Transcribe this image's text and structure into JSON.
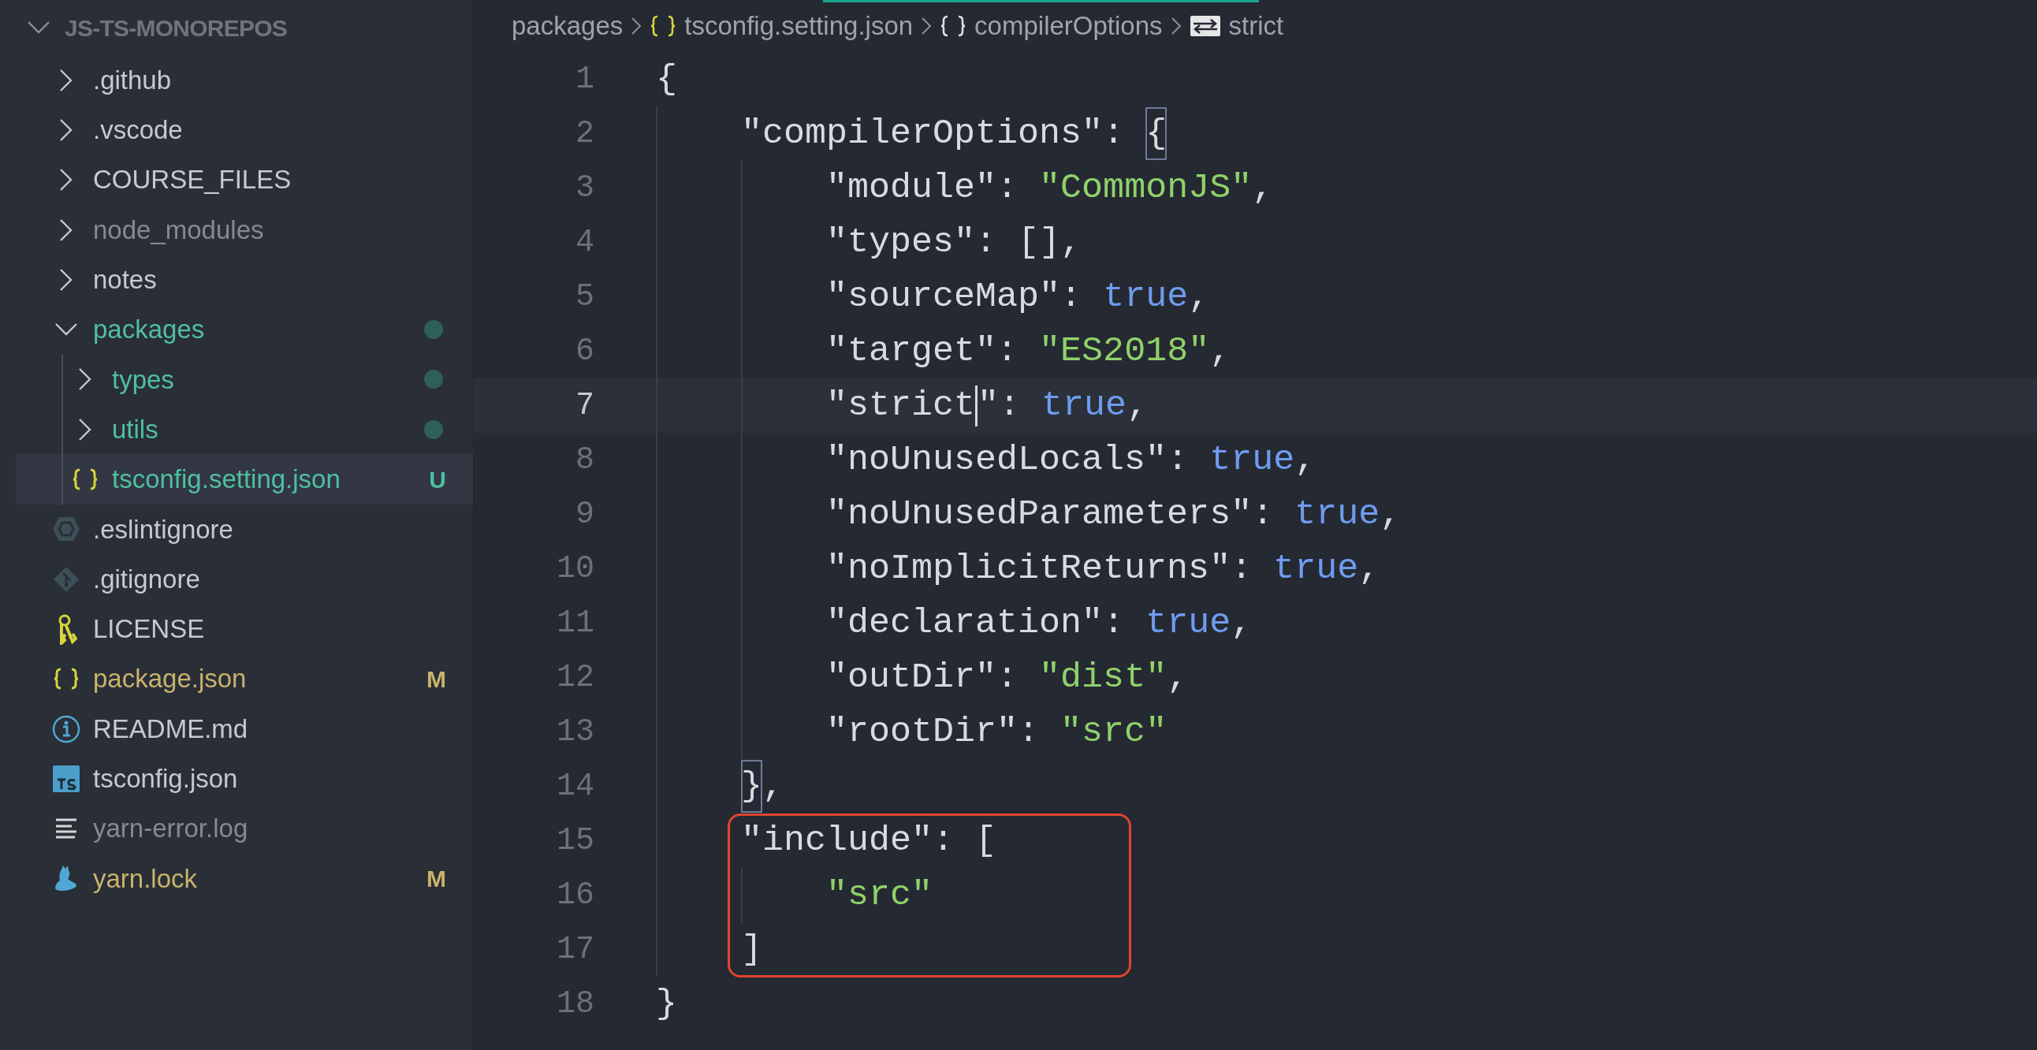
{
  "sidebar": {
    "title": "JS-TS-MONOREPOS",
    "expanded": true,
    "items": [
      {
        "label": ".github",
        "kind": "folder",
        "expanded": false,
        "color": "#c6c9cf",
        "selected": false
      },
      {
        "label": ".vscode",
        "kind": "folder",
        "expanded": false,
        "color": "#c6c9cf",
        "selected": false
      },
      {
        "label": "COURSE_FILES",
        "kind": "folder",
        "expanded": false,
        "color": "#c6c9cf",
        "selected": false
      },
      {
        "label": "node_modules",
        "kind": "folder",
        "expanded": false,
        "color": "#858992",
        "selected": false
      },
      {
        "label": "notes",
        "kind": "folder",
        "expanded": false,
        "color": "#c6c9cf",
        "selected": false
      },
      {
        "label": "packages",
        "kind": "folder",
        "expanded": true,
        "color": "#4fbfa3",
        "dot": true,
        "selected": false,
        "children": [
          {
            "label": "types",
            "kind": "folder",
            "expanded": false,
            "color": "#4fbfa3",
            "dot": true,
            "selected": false
          },
          {
            "label": "utils",
            "kind": "folder",
            "expanded": false,
            "color": "#4fbfa3",
            "dot": true,
            "selected": false
          },
          {
            "label": "tsconfig.setting.json",
            "kind": "json",
            "color": "#4fbfa3",
            "badge": "U",
            "selected": true
          }
        ]
      },
      {
        "label": ".eslintignore",
        "kind": "eslint",
        "color": "#c6c9cf",
        "selected": false
      },
      {
        "label": ".gitignore",
        "kind": "git",
        "color": "#c6c9cf",
        "selected": false
      },
      {
        "label": "LICENSE",
        "kind": "license",
        "color": "#c6c9cf",
        "selected": false
      },
      {
        "label": "package.json",
        "kind": "json",
        "color": "#c8b36b",
        "badge": "M",
        "selected": false
      },
      {
        "label": "README.md",
        "kind": "readme",
        "color": "#c6c9cf",
        "selected": false
      },
      {
        "label": "tsconfig.json",
        "kind": "ts",
        "color": "#c6c9cf",
        "selected": false
      },
      {
        "label": "yarn-error.log",
        "kind": "log",
        "color": "#858992",
        "selected": false
      },
      {
        "label": "yarn.lock",
        "kind": "yarn",
        "color": "#c8b36b",
        "badge": "M",
        "selected": false
      }
    ]
  },
  "breadcrumbs": [
    {
      "label": "packages",
      "kind": "folder"
    },
    {
      "label": "tsconfig.setting.json",
      "kind": "json"
    },
    {
      "label": "compilerOptions",
      "kind": "object"
    },
    {
      "label": "strict",
      "kind": "field"
    }
  ],
  "editor": {
    "lines": [
      {
        "number": "1",
        "current": false,
        "tokens": [
          {
            "kind": "punct",
            "text": "{"
          }
        ]
      },
      {
        "number": "2",
        "current": false,
        "tokens": [
          {
            "kind": "key",
            "text": "    \"compilerOptions\""
          },
          {
            "kind": "punct",
            "text": ": "
          },
          {
            "kind": "punct",
            "text": "{",
            "matched": true
          }
        ]
      },
      {
        "number": "3",
        "current": false,
        "tokens": [
          {
            "kind": "key",
            "text": "        \"module\""
          },
          {
            "kind": "punct",
            "text": ": "
          },
          {
            "kind": "string",
            "text": "\"CommonJS\""
          },
          {
            "kind": "punct",
            "text": ","
          }
        ]
      },
      {
        "number": "4",
        "current": false,
        "tokens": [
          {
            "kind": "key",
            "text": "        \"types\""
          },
          {
            "kind": "punct",
            "text": ": [],"
          }
        ]
      },
      {
        "number": "5",
        "current": false,
        "tokens": [
          {
            "kind": "key",
            "text": "        \"sourceMap\""
          },
          {
            "kind": "punct",
            "text": ": "
          },
          {
            "kind": "keyword",
            "text": "true"
          },
          {
            "kind": "punct",
            "text": ","
          }
        ]
      },
      {
        "number": "6",
        "current": false,
        "tokens": [
          {
            "kind": "key",
            "text": "        \"target\""
          },
          {
            "kind": "punct",
            "text": ": "
          },
          {
            "kind": "string",
            "text": "\"ES2018\""
          },
          {
            "kind": "punct",
            "text": ","
          }
        ]
      },
      {
        "number": "7",
        "current": true,
        "tokens": [
          {
            "kind": "key",
            "text": "        \"strict"
          },
          {
            "kind": "cursor"
          },
          {
            "kind": "key",
            "text": "\""
          },
          {
            "kind": "punct",
            "text": ": "
          },
          {
            "kind": "keyword",
            "text": "true"
          },
          {
            "kind": "punct",
            "text": ","
          }
        ]
      },
      {
        "number": "8",
        "current": false,
        "tokens": [
          {
            "kind": "key",
            "text": "        \"noUnusedLocals\""
          },
          {
            "kind": "punct",
            "text": ": "
          },
          {
            "kind": "keyword",
            "text": "true"
          },
          {
            "kind": "punct",
            "text": ","
          }
        ]
      },
      {
        "number": "9",
        "current": false,
        "tokens": [
          {
            "kind": "key",
            "text": "        \"noUnusedParameters\""
          },
          {
            "kind": "punct",
            "text": ": "
          },
          {
            "kind": "keyword",
            "text": "true"
          },
          {
            "kind": "punct",
            "text": ","
          }
        ]
      },
      {
        "number": "10",
        "current": false,
        "tokens": [
          {
            "kind": "key",
            "text": "        \"noImplicitReturns\""
          },
          {
            "kind": "punct",
            "text": ": "
          },
          {
            "kind": "keyword",
            "text": "true"
          },
          {
            "kind": "punct",
            "text": ","
          }
        ]
      },
      {
        "number": "11",
        "current": false,
        "tokens": [
          {
            "kind": "key",
            "text": "        \"declaration\""
          },
          {
            "kind": "punct",
            "text": ": "
          },
          {
            "kind": "keyword",
            "text": "true"
          },
          {
            "kind": "punct",
            "text": ","
          }
        ]
      },
      {
        "number": "12",
        "current": false,
        "tokens": [
          {
            "kind": "key",
            "text": "        \"outDir\""
          },
          {
            "kind": "punct",
            "text": ": "
          },
          {
            "kind": "string",
            "text": "\"dist\""
          },
          {
            "kind": "punct",
            "text": ","
          }
        ]
      },
      {
        "number": "13",
        "current": false,
        "tokens": [
          {
            "kind": "key",
            "text": "        \"rootDir\""
          },
          {
            "kind": "punct",
            "text": ": "
          },
          {
            "kind": "string",
            "text": "\"src\""
          }
        ]
      },
      {
        "number": "14",
        "current": false,
        "tokens": [
          {
            "kind": "punct",
            "text": "    }",
            "matched": true
          },
          {
            "kind": "punct",
            "text": ","
          }
        ]
      },
      {
        "number": "15",
        "current": false,
        "tokens": [
          {
            "kind": "key",
            "text": "    \"include\""
          },
          {
            "kind": "punct",
            "text": ": ["
          }
        ]
      },
      {
        "number": "16",
        "current": false,
        "tokens": [
          {
            "kind": "string",
            "text": "        \"src\""
          }
        ]
      },
      {
        "number": "17",
        "current": false,
        "tokens": [
          {
            "kind": "punct",
            "text": "    ]"
          }
        ]
      },
      {
        "number": "18",
        "current": false,
        "tokens": [
          {
            "kind": "punct",
            "text": "}"
          }
        ]
      }
    ]
  }
}
